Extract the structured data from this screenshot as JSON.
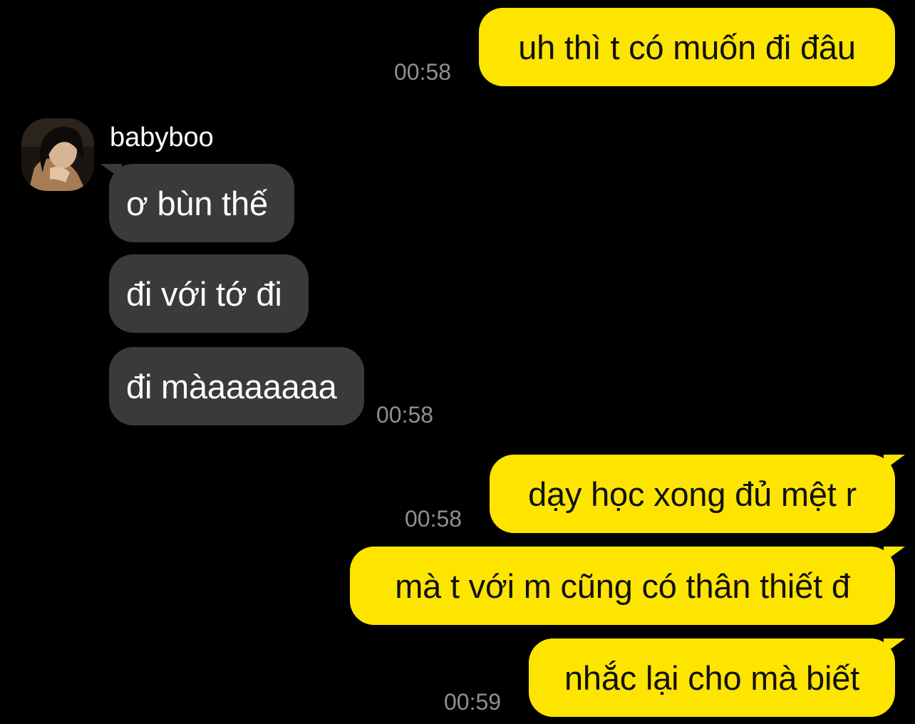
{
  "messages": [
    {
      "text": "uh thì t có muốn đi đâu",
      "time": "00:58"
    },
    {
      "text": "ơ bùn thế"
    },
    {
      "text": "đi với tớ đi"
    },
    {
      "text": "đi màaaaaaaa",
      "time": "00:58"
    },
    {
      "text": "dạy học xong đủ mệt r",
      "time": "00:58"
    },
    {
      "text": "mà t với m cũng có thân thiết đ"
    },
    {
      "text": "nhắc lại cho mà biết",
      "time": "00:59"
    }
  ],
  "contact": {
    "name": "babyboo",
    "avatar_icon": "profile-photo"
  },
  "colors": {
    "background": "#000000",
    "outgoing_bubble": "#FEE500",
    "incoming_bubble": "#3A3A3C",
    "timestamp": "#8E8E93"
  }
}
